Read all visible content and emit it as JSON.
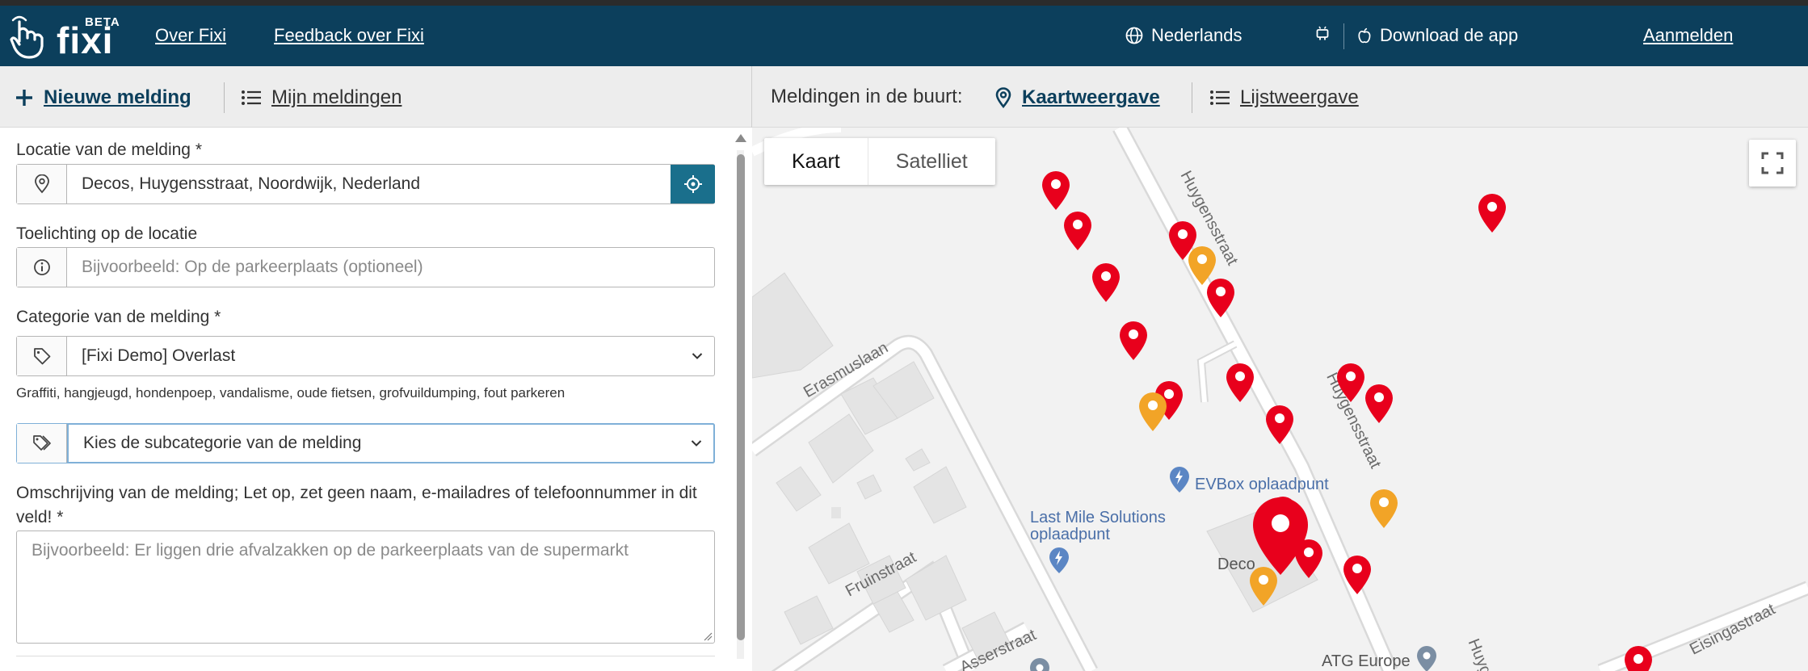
{
  "header": {
    "logo_text": "fixi",
    "logo_badge": "BETA",
    "links": [
      "Over Fixi",
      "Feedback over Fixi"
    ],
    "language": "Nederlands",
    "download": "Download de app",
    "login": "Aanmelden"
  },
  "subnav": {
    "new_report": "Nieuwe melding",
    "my_reports": "Mijn meldingen",
    "nearby_label": "Meldingen in de buurt:",
    "map_view": "Kaartweergave",
    "list_view": "Lijstweergave"
  },
  "form": {
    "location_label": "Locatie van de melding *",
    "location_value": "Decos, Huygensstraat, Noordwijk, Nederland",
    "location_note_label": "Toelichting op de locatie",
    "location_note_placeholder": "Bijvoorbeeld: Op de parkeerplaats (optioneel)",
    "category_label": "Categorie van de melding *",
    "category_value": "[Fixi Demo] Overlast",
    "category_hint": "Graffiti, hangjeugd, hondenpoep, vandalisme, oude fietsen, grofvuildumping, fout parkeren",
    "subcategory_placeholder": "Kies de subcategorie van de melding",
    "description_label": "Omschrijving van de melding; Let op, zet geen naam, e-mailadres of telefoonnummer in dit veld! *",
    "description_placeholder": "Bijvoorbeeld: Er liggen drie afvalzakken op de parkeerplaats van de supermarkt"
  },
  "map": {
    "tabs": [
      "Kaart",
      "Satelliet"
    ],
    "streets": [
      "Huygensstraat",
      "Erasmuslaan",
      "Fruinstraat",
      "Asserstraat",
      "Eisingastraat",
      "Huygensstraat",
      "Huyg"
    ],
    "poi": [
      "EVBox oplaadpunt",
      "Last Mile Solutions",
      "oplaadpunt",
      "Deco",
      "ATG Europe"
    ],
    "pin_colors": {
      "red": "#e8001c",
      "orange": "#f2a427"
    }
  }
}
